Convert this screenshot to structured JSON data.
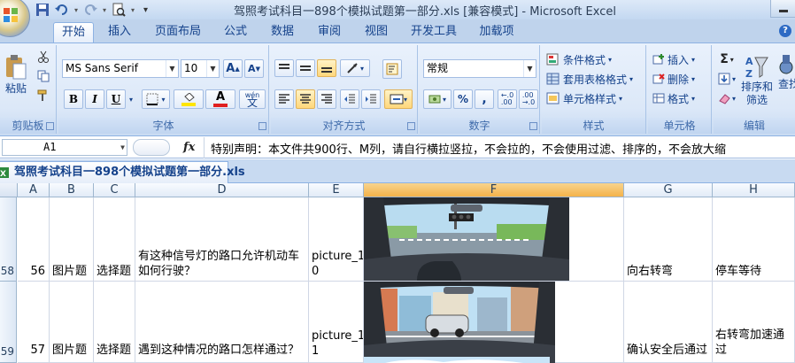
{
  "window": {
    "title": "驾照考试科目一898个模拟试题第一部分.xls  [兼容模式] - Microsoft Excel"
  },
  "quick_access": {
    "icons": [
      "save-icon",
      "undo-icon",
      "redo-icon",
      "print-preview-icon",
      "customize-icon"
    ]
  },
  "ribbon_tabs": [
    "开始",
    "插入",
    "页面布局",
    "公式",
    "数据",
    "审阅",
    "视图",
    "开发工具",
    "加载项"
  ],
  "active_tab": "开始",
  "help": "?",
  "ribbon": {
    "clipboard": {
      "label": "剪贴板",
      "paste": "粘贴"
    },
    "font": {
      "label": "字体",
      "font_name": "MS Sans Serif",
      "font_size": "10",
      "bold": "B",
      "italic": "I",
      "underline": "U",
      "font_color_letter": "A",
      "phonetic": "wén",
      "phonetic_char": "文"
    },
    "alignment": {
      "label": "对齐方式"
    },
    "number": {
      "label": "数字",
      "format": "常规",
      "percent": "%",
      "comma": ","
    },
    "styles": {
      "label": "样式",
      "conditional": "条件格式",
      "table": "套用表格格式",
      "cell_styles": "单元格样式"
    },
    "cells": {
      "label": "单元格",
      "insert": "插入",
      "delete": "删除",
      "format": "格式"
    },
    "editing": {
      "label": "编辑",
      "sort_filter_1": "排序和",
      "sort_filter_2": "筛选",
      "find_1": "查找",
      "sigma": "Σ"
    }
  },
  "formula_bar": {
    "cell_ref": "A1",
    "fx": "fx",
    "content": "特别声明：本文件共900行、M列，请自行横拉竖拉，不会拉的，不会使用过滤、排序的，不会放大缩"
  },
  "workbook_tab": "驾照考试科目一898个模拟试题第一部分.xls",
  "columns": [
    "A",
    "B",
    "C",
    "D",
    "E",
    "F",
    "G",
    "H"
  ],
  "rows": [
    {
      "num": "58",
      "A": "56",
      "B": "图片题",
      "C": "选择题",
      "D1": "有这种信号灯的路口允许机动车",
      "D2": "如何行驶？",
      "E1": "picture_1",
      "E2": "0",
      "G": "向右转弯",
      "H": "停车等待"
    },
    {
      "num": "59",
      "A": "57",
      "B": "图片题",
      "C": "选择题",
      "D1": "遇到这种情况的路口怎样通过？",
      "D2": "",
      "E1": "picture_1",
      "E2": "1",
      "G": "确认安全后通过",
      "H": "右转弯加速通过"
    }
  ],
  "colors": {
    "ribbon_bg": "#dce8f8",
    "selected_col_header": "#f4b24a",
    "font_color_bar": "#e02020",
    "fill_color_bar": "#ffe500"
  }
}
